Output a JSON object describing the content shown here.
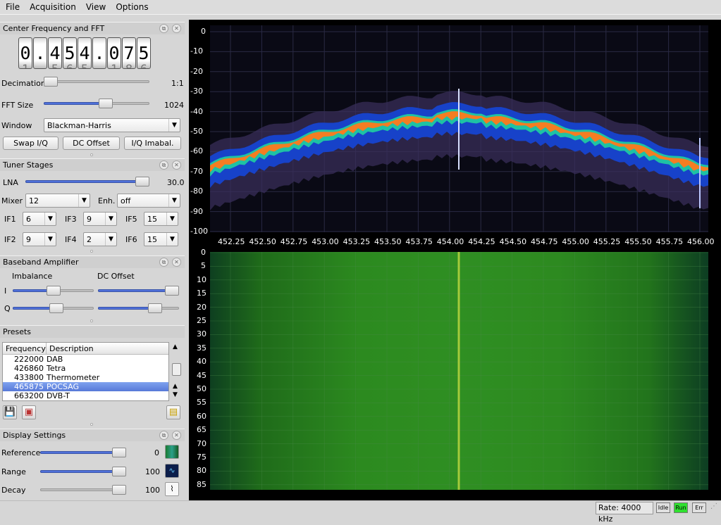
{
  "menu": [
    "File",
    "Acquisition",
    "View",
    "Options"
  ],
  "panels": {
    "center": {
      "title": "Center Frequency and FFT",
      "digits": [
        "0",
        ".",
        "4",
        "5",
        "4",
        ".",
        "0",
        "7",
        "5"
      ],
      "digits_next": [
        "1",
        "",
        "5",
        "6",
        "5",
        "",
        "1",
        "8",
        "6"
      ],
      "decimation_label": "Decimation",
      "decimation_value": "1:1",
      "decimation_level": 0.0,
      "fft_label": "FFT Size",
      "fft_value": "1024",
      "fft_level": 0.6,
      "window_label": "Window",
      "window_value": "Blackman-Harris",
      "btn_swap": "Swap I/Q",
      "btn_dc": "DC Offset",
      "btn_iq": "I/Q Imabal."
    },
    "tuner": {
      "title": "Tuner Stages",
      "lna_label": "LNA",
      "lna_value": "30.0",
      "lna_level": 1.0,
      "mixer_label": "Mixer",
      "mixer_value": "12",
      "enh_label": "Enh.",
      "enh_value": "off",
      "if1_label": "IF1",
      "if1": "6",
      "if3_label": "IF3",
      "if3": "9",
      "if5_label": "IF5",
      "if5": "15",
      "if2_label": "IF2",
      "if2": "9",
      "if4_label": "IF4",
      "if4": "2",
      "if6_label": "IF6",
      "if6": "15"
    },
    "baseband": {
      "title": "Baseband Amplifier",
      "imbalance_label": "Imbalance",
      "dc_label": "DC Offset",
      "i_label": "I",
      "q_label": "Q",
      "i_imb": 0.5,
      "q_imb": 0.55,
      "i_dc": 1.0,
      "q_dc": 0.75
    },
    "presets": {
      "title": "Presets",
      "col_freq": "Frequency",
      "col_desc": "Description",
      "rows": [
        {
          "freq": "222000",
          "desc": "DAB"
        },
        {
          "freq": "426860",
          "desc": "Tetra"
        },
        {
          "freq": "433800",
          "desc": "Thermometer"
        },
        {
          "freq": "465875",
          "desc": "POCSAG"
        },
        {
          "freq": "663200",
          "desc": "DVB-T"
        }
      ],
      "selected": 3
    },
    "display": {
      "title": "Display Settings",
      "ref_label": "Reference",
      "ref_value": "0",
      "ref_level": 1.0,
      "range_label": "Range",
      "range_value": "100",
      "range_level": 1.0,
      "decay_label": "Decay",
      "decay_value": "100",
      "decay_level": 1.0
    }
  },
  "fft_axis": {
    "y_ticks": [
      "0",
      "-10",
      "-20",
      "-30",
      "-40",
      "-50",
      "-60",
      "-70",
      "-80",
      "-90",
      "-100"
    ],
    "x_ticks": [
      "452.25",
      "452.50",
      "452.75",
      "453.00",
      "453.25",
      "453.50",
      "453.75",
      "454.00",
      "454.25",
      "454.50",
      "454.75",
      "455.00",
      "455.25",
      "455.50",
      "455.75",
      "456.00"
    ]
  },
  "wf_axis": {
    "y_ticks": [
      "0",
      "5",
      "10",
      "15",
      "20",
      "25",
      "30",
      "35",
      "40",
      "45",
      "50",
      "55",
      "60",
      "65",
      "70",
      "75",
      "80",
      "85"
    ]
  },
  "status": {
    "rate": "Rate: 4000 kHz",
    "idle": "Idle",
    "run": "Run",
    "err": "Err"
  }
}
